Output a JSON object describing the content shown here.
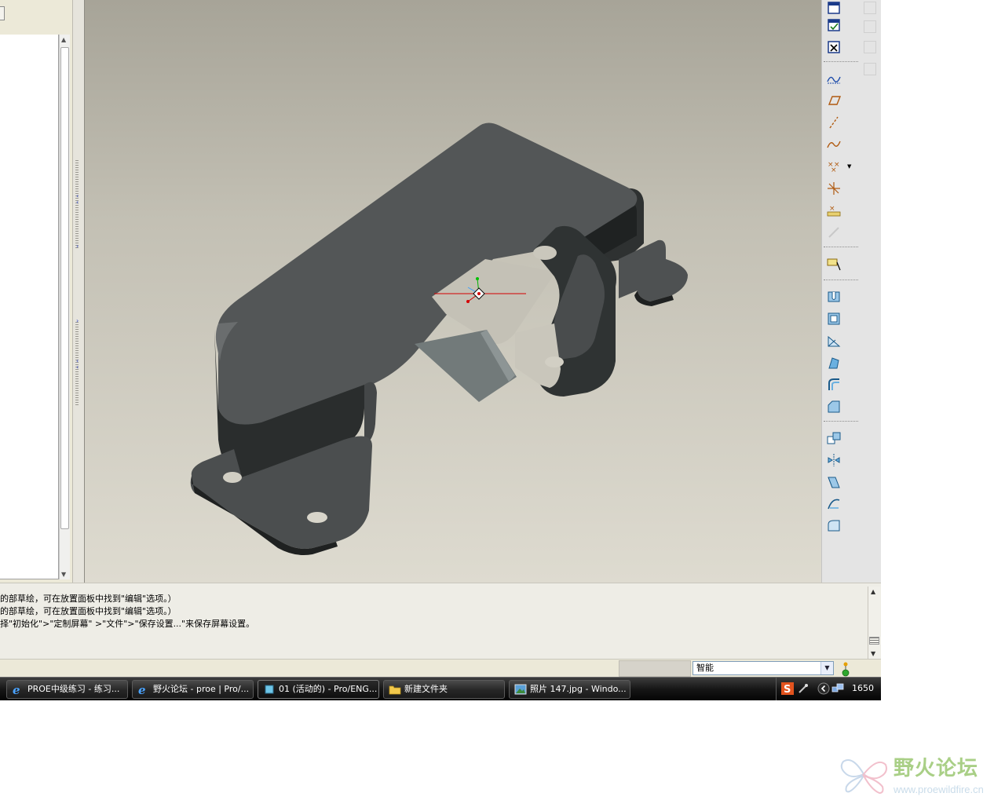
{
  "messages": {
    "lines": [
      "的部草绘，可在放置面板中找到\"编辑\"选项。）",
      "的部草绘，可在放置面板中找到\"编辑\"选项。）",
      "择\"初始化\">\"定制屏幕\" >\"文件\">\"保存设置...\"来保存屏幕设置。"
    ]
  },
  "status": {
    "filter_value": "智能"
  },
  "taskbar": {
    "tasks": [
      {
        "label": "PROE中级练习 - 练习...",
        "icon": "ie-icon"
      },
      {
        "label": "野火论坛 - proe | Pro/...",
        "icon": "ie-icon"
      },
      {
        "label": "01 (活动的) - Pro/ENG...",
        "icon": "proe-icon"
      },
      {
        "label": "新建文件夹",
        "icon": "folder-icon"
      },
      {
        "label": "照片 147.jpg - Windo...",
        "icon": "image-viewer-icon"
      }
    ],
    "clock": "1650"
  },
  "right_toolbar": {
    "icons": [
      "window-icon",
      "window-check-icon",
      "window-close-icon",
      "sketch-tool-icon",
      "datum-plane-icon",
      "datum-axis-icon",
      "datum-curve-icon",
      "datum-point-icon",
      "coordinate-system-icon",
      "analysis-feature-icon",
      "disabled-datum-icon",
      "annotation-icon",
      "hole-icon",
      "shell-icon",
      "rib-icon",
      "draft-icon",
      "round-icon",
      "chamfer-icon",
      "copy-feature-icon",
      "mirror-icon",
      "merge-icon",
      "trim-icon",
      "extend-icon"
    ]
  },
  "watermark": {
    "title": "野火论坛",
    "url": "www.proewildfire.cn"
  },
  "colors": {
    "viewport_top": "#a7a498",
    "viewport_bottom": "#dedbd0",
    "part_dark": "#2d3030",
    "part_face": "#535657",
    "taskbar": "#1a1a1a",
    "watermark_green": "#a9cf86"
  }
}
